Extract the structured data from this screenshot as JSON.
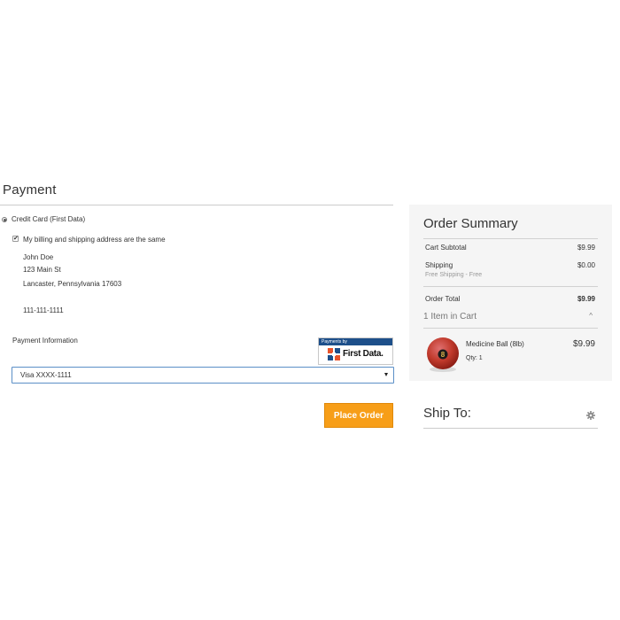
{
  "payment": {
    "title": "Payment",
    "method_label": "Credit Card (First Data)",
    "same_address_label": "My billing and shipping address are the same",
    "address": {
      "name": "John Doe",
      "street": "123 Main St",
      "city_line": "Lancaster, Pennsylvania 17603",
      "phone": "111-111-1111"
    },
    "payment_info_label": "Payment Information",
    "badge": {
      "header": "Payments by",
      "brand": "First Data."
    },
    "card_select": {
      "selected": "Visa XXXX-1111"
    },
    "place_order_label": "Place Order"
  },
  "summary": {
    "title": "Order Summary",
    "cart_subtotal_label": "Cart Subtotal",
    "cart_subtotal_value": "$9.99",
    "shipping_label": "Shipping",
    "shipping_value": "$0.00",
    "shipping_note": "Free Shipping - Free",
    "order_total_label": "Order Total",
    "order_total_value": "$9.99",
    "items_in_cart_label": "1 Item in Cart",
    "toggle_icon": "^",
    "item": {
      "name": "Medicine Ball (8lb)",
      "qty_label": "Qty: 1",
      "price": "$9.99",
      "ball_number": "8"
    }
  },
  "ship_to": {
    "title": "Ship To:"
  },
  "colors": {
    "accent_button": "#f79e18",
    "summary_bg": "#f5f5f5",
    "select_border": "#5b8fc7",
    "first_data_blue": "#1d4f8a"
  }
}
